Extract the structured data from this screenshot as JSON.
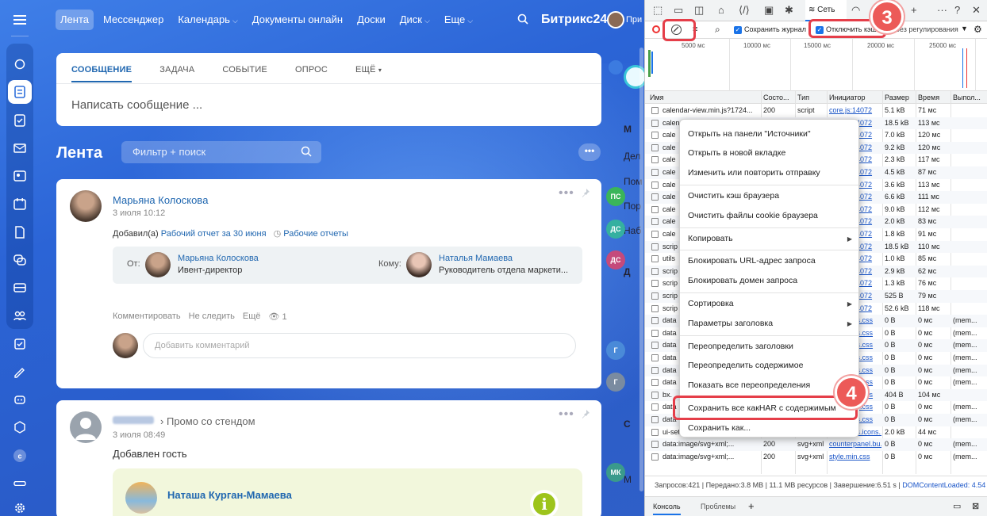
{
  "topnav": {
    "items": [
      "Лента",
      "Мессенджер",
      "Календарь",
      "Документы онлайн",
      "Доски",
      "Диск",
      "Еще"
    ],
    "brand": "Битрикс",
    "brand_num": "24",
    "user": "При"
  },
  "composer": {
    "tabs": [
      "СООБЩЕНИЕ",
      "ЗАДАЧА",
      "СОБЫТИЕ",
      "ОПРОС",
      "ЕЩЁ"
    ],
    "placeholder": "Написать сообщение ..."
  },
  "feed": {
    "title": "Лента",
    "search_placeholder": "Фильтр + поиск",
    "more": "•••"
  },
  "post1": {
    "author": "Марьяна Колосковa",
    "date": "3 июля 10:12",
    "added": "Добавил(а)",
    "report_link": "Рабочий отчет за 30 июня",
    "reports": "Рабочие отчеты",
    "from_label": "От:",
    "from_name": "Марьяна Колоскова",
    "from_role": "Ивент-директор",
    "to_label": "Кому:",
    "to_name": "Наталья Мамаева",
    "to_role": "Руководитель отдела маркети...",
    "actions": [
      "Комментировать",
      "Не следить",
      "Ещё"
    ],
    "views": "1",
    "comment_placeholder": "Добавить комментарий"
  },
  "post2": {
    "arrow": "›",
    "target": "Промо со стендом",
    "date": "3 июля 08:49",
    "text": "Добавлен гость",
    "guest_name": "Наташа Курган-Мамаева",
    "info": "i"
  },
  "rightstrip": {
    "texts": [
      "М",
      "Дел",
      "Пом",
      "Пор",
      "Наб",
      "Д",
      "С",
      "М"
    ],
    "dots": [
      "ПС",
      "ДС",
      "ДС",
      "Г",
      "Г",
      "МК"
    ]
  },
  "devtools": {
    "network_tab": "Сеть",
    "preserve_log": "Сохранить журнал",
    "disable_cache": "Отключить кэш",
    "throttle": "Без регулирования",
    "timeline": [
      "5000 мс",
      "10000 мс",
      "15000 мс",
      "20000 мс",
      "25000 мс"
    ],
    "columns": [
      "Имя",
      "Состо...",
      "Тип",
      "Инициатор",
      "Размер",
      "Время",
      "Выпол..."
    ],
    "rows": [
      [
        "calendar-view.min.js?1724...",
        "200",
        "script",
        "core.js:14072",
        "5.1 kB",
        "71 мс"
      ],
      [
        "calendar-view-day-week.m...",
        "200",
        "script",
        "core.js:14072",
        "18.5 kB",
        "113 мс"
      ],
      [
        "cale",
        "200",
        "script",
        "core.js:14072",
        "7.0 kB",
        "120 мс"
      ],
      [
        "cale",
        "200",
        "script",
        "core.js:14072",
        "9.2 kB",
        "120 мс"
      ],
      [
        "cale",
        "200",
        "script",
        "core.js:14072",
        "2.3 kB",
        "117 мс"
      ],
      [
        "cale",
        "200",
        "script",
        "core.js:14072",
        "4.5 kB",
        "87 мс"
      ],
      [
        "cale",
        "200",
        "script",
        "core.js:14072",
        "3.6 kB",
        "113 мс"
      ],
      [
        "cale",
        "200",
        "script",
        "core.js:14072",
        "6.6 kB",
        "111 мс"
      ],
      [
        "cale",
        "200",
        "script",
        "core.js:14072",
        "9.0 kB",
        "112 мс"
      ],
      [
        "cale",
        "200",
        "script",
        "core.js:14072",
        "2.0 kB",
        "83 мс"
      ],
      [
        "cale",
        "200",
        "script",
        "core.js:14072",
        "1.8 kB",
        "91 мс"
      ],
      [
        "scrip",
        "200",
        "script",
        "core.js:14072",
        "18.5 kB",
        "110 мс"
      ],
      [
        "utils",
        "200",
        "script",
        "core.js:14072",
        "1.0 kB",
        "85 мс"
      ],
      [
        "scrip",
        "200",
        "script",
        "core.js:14072",
        "2.9 kB",
        "62 мс"
      ],
      [
        "scrip",
        "200",
        "script",
        "core.js:14072",
        "1.3 kB",
        "76 мс"
      ],
      [
        "scrip",
        "200",
        "script",
        "core.js:14072",
        "525 B",
        "79 мс"
      ],
      [
        "scrip",
        "200",
        "script",
        "core.js:14072",
        "52.6 kB",
        "118 мс"
      ],
      [
        "data",
        "200",
        "svg+xml",
        "ui.buttons.css",
        "0 B",
        "0 мс",
        "(mem..."
      ],
      [
        "data",
        "200",
        "svg+xml",
        "ui.buttons.css",
        "0 B",
        "0 мс",
        "(mem..."
      ],
      [
        "data",
        "200",
        "svg+xml",
        "ui.buttons.css",
        "0 B",
        "0 мс",
        "(mem..."
      ],
      [
        "data",
        "200",
        "svg+xml",
        "ui.buttons.css",
        "0 B",
        "0 мс",
        "(mem..."
      ],
      [
        "data",
        "200",
        "svg+xml",
        "ui.buttons.css",
        "0 B",
        "0 мс",
        "(mem..."
      ],
      [
        "data",
        "200",
        "svg+xml",
        "ui.buttons.css",
        "0 B",
        "0 мс",
        "(mem..."
      ],
      [
        "bx.",
        "200",
        "svg+xml",
        "ui.buttons.css",
        "404 B",
        "104 мс"
      ],
      [
        "data",
        "200",
        "svg+xml",
        "ui.buttons.css",
        "0 B",
        "0 мс",
        "(mem..."
      ],
      [
        "data",
        "200",
        "svg+xml",
        "ui.buttons.css",
        "0 B",
        "0 мс",
        "(mem..."
      ],
      [
        "ui-setting-white.svg?v=1.1",
        "200",
        "svg+xml",
        "ui.buttons.icons...",
        "2.0 kB",
        "44 мс"
      ],
      [
        "data:image/svg+xml;...",
        "200",
        "svg+xml",
        "counterpanel.bu...",
        "0 B",
        "0 мс",
        "(mem..."
      ],
      [
        "data:image/svg+xml;...",
        "200",
        "svg+xml",
        "style.min.css",
        "0 B",
        "0 мс",
        "(mem..."
      ]
    ],
    "status": [
      "Запросов:421",
      "Передано:3.8 MB",
      "11.1 MB ресурсов",
      "Завершение:6.51 s",
      "DOMContentLoaded: 4.54"
    ],
    "bottom_tabs": [
      "Консоль",
      "Проблемы"
    ]
  },
  "context_menu": {
    "items": [
      "Открыть на панели \"Источники\"",
      "Открыть в новой вкладке",
      "Изменить или повторить отправку",
      "Очистить кэш браузера",
      "Очистить файлы cookie браузера",
      "Копировать",
      "Блокировать URL-адрес запроса",
      "Блокировать домен запроса",
      "Сортировка",
      "Параметры заголовка",
      "Переопределить заголовки",
      "Переопределить содержимое",
      "Показать все переопределения",
      "Сохранить все какHAR с содержимым",
      "Сохранить как..."
    ]
  },
  "badges": [
    "3",
    "4"
  ],
  "colors": {
    "accent": "#2067b0",
    "highlight": "#e53e49",
    "badge": "#ec5a58",
    "app_blue": "#2b64d6"
  }
}
